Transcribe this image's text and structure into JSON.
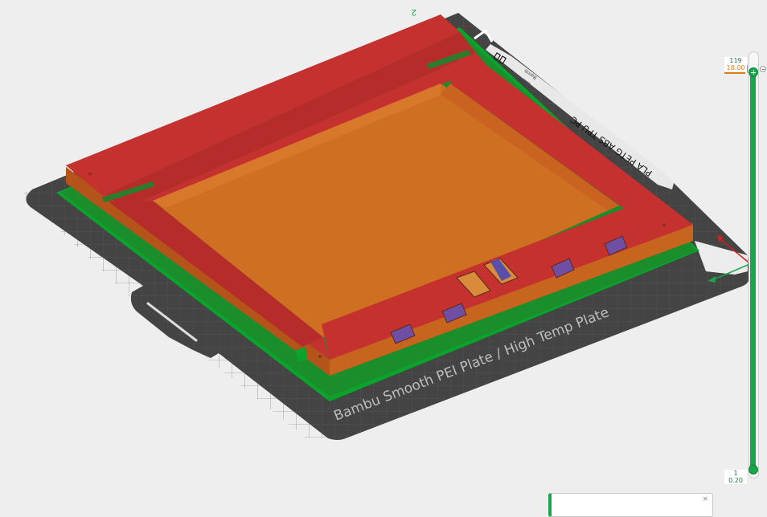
{
  "plate": {
    "label": "Bambu Smooth PEI Plate / High Temp Plate",
    "filament_text": "PLA PETG ABS TPU PC",
    "corner_marker": "2",
    "tag_lines": [
      "Bamb",
      "Lab"
    ]
  },
  "layer_slider": {
    "top_layer": "119",
    "top_height": "18.00",
    "bottom_layer": "1",
    "bottom_height": "0.20"
  },
  "icons": {
    "slider_handle_top": "plus-icon",
    "slider_handle_bottom": "circle-handle-icon",
    "slider_option": "circle-minus-icon"
  },
  "colors": {
    "background": "#eeeeee",
    "plate": "#444444",
    "model_top": "#c4312f",
    "model_side": "#c7641e",
    "brim": "#0aa32b",
    "slider": "#1aa64a",
    "accent": "#e07b1a"
  },
  "notification": {
    "close": "×"
  }
}
